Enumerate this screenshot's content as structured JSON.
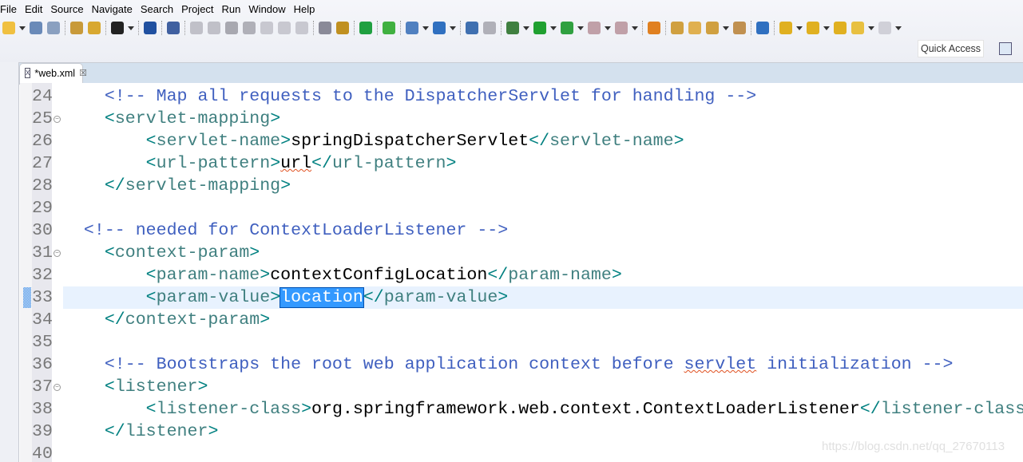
{
  "menu": [
    "File",
    "Edit",
    "Source",
    "Navigate",
    "Search",
    "Project",
    "Run",
    "Window",
    "Help"
  ],
  "toolbar": [
    {
      "icon": "new-icon",
      "c": "#f0c040"
    },
    {
      "dd": 1
    },
    {
      "icon": "save-icon",
      "c": "#6a8ab8"
    },
    {
      "icon": "save-all-icon",
      "c": "#8aa0c0"
    },
    {
      "sep": 1
    },
    {
      "icon": "open-type-icon",
      "c": "#c89a3a"
    },
    {
      "icon": "open-resource-icon",
      "c": "#d8a830"
    },
    {
      "sep": 1
    },
    {
      "icon": "user-icon",
      "c": "#222"
    },
    {
      "dd": 1
    },
    {
      "sep": 1
    },
    {
      "icon": "console-icon",
      "c": "#2050a0"
    },
    {
      "sep": 1
    },
    {
      "icon": "skip-breakpoints-icon",
      "c": "#4060a0"
    },
    {
      "sep": 1
    },
    {
      "icon": "resume-icon",
      "c": "#c0c0c8"
    },
    {
      "icon": "suspend-icon",
      "c": "#c0c0c8"
    },
    {
      "icon": "terminate-icon",
      "c": "#a8a8b0"
    },
    {
      "icon": "disconnect-icon",
      "c": "#b0b0b8"
    },
    {
      "icon": "step-into-icon",
      "c": "#c8c8d0"
    },
    {
      "icon": "step-over-icon",
      "c": "#c8c8d0"
    },
    {
      "icon": "step-return-icon",
      "c": "#c8c8d0"
    },
    {
      "sep": 1
    },
    {
      "icon": "drop-to-frame-icon",
      "c": "#8a8a98"
    },
    {
      "icon": "use-step-filters-icon",
      "c": "#c09020"
    },
    {
      "sep": 1
    },
    {
      "icon": "spring-boot-icon",
      "c": "#20a040"
    },
    {
      "sep": 1
    },
    {
      "icon": "spring-notification-icon",
      "c": "#40b040"
    },
    {
      "sep": 1
    },
    {
      "icon": "new-server-icon",
      "c": "#5080c0"
    },
    {
      "dd": 1
    },
    {
      "icon": "new-spring-icon",
      "c": "#3070c0"
    },
    {
      "dd": 1
    },
    {
      "sep": 1
    },
    {
      "icon": "run-server-icon",
      "c": "#4070b0"
    },
    {
      "icon": "misc-icon",
      "c": "#b0b0b8"
    },
    {
      "sep": 1
    },
    {
      "icon": "debug-icon",
      "c": "#408040"
    },
    {
      "dd": 1
    },
    {
      "icon": "run-icon",
      "c": "#20a030"
    },
    {
      "dd": 1
    },
    {
      "icon": "run-external-tools-icon",
      "c": "#30a040"
    },
    {
      "dd": 1
    },
    {
      "icon": "stop-icon",
      "c": "#c0a0a8"
    },
    {
      "dd": 1
    },
    {
      "icon": "deploy-icon",
      "c": "#c0a0a8"
    },
    {
      "dd": 1
    },
    {
      "sep": 1
    },
    {
      "icon": "open-aspectj-icon",
      "c": "#e08020"
    },
    {
      "sep": 1
    },
    {
      "icon": "open-project-icon",
      "c": "#d0a040"
    },
    {
      "icon": "open-folder-icon",
      "c": "#e0b050"
    },
    {
      "icon": "pen-icon",
      "c": "#d0a040"
    },
    {
      "dd": 1
    },
    {
      "icon": "open-archive-icon",
      "c": "#c09050"
    },
    {
      "sep": 1
    },
    {
      "icon": "globe-icon",
      "c": "#3070c0"
    },
    {
      "sep": 1
    },
    {
      "icon": "next-annotation-icon",
      "c": "#e0b020"
    },
    {
      "dd": 1
    },
    {
      "icon": "previous-annotation-icon",
      "c": "#e0b020"
    },
    {
      "dd": 1
    },
    {
      "icon": "last-edit-location-icon",
      "c": "#e0b020"
    },
    {
      "icon": "back-icon",
      "c": "#e8c040"
    },
    {
      "dd": 1
    },
    {
      "icon": "forward-icon",
      "c": "#d0d0d8"
    },
    {
      "dd": 1
    }
  ],
  "quick_access": "Quick Access",
  "tab": {
    "title": "*web.xml",
    "file_icon": "X",
    "close": "☒"
  },
  "current_line": 33,
  "lines": [
    {
      "n": "24",
      "seg": [
        [
          "cm",
          "    <!-- Map all requests to the DispatcherServlet for handling -->"
        ]
      ]
    },
    {
      "n": "25",
      "fold": 1,
      "seg": [
        [
          "tx",
          "    "
        ],
        [
          "br",
          "<"
        ],
        [
          "tag",
          "servlet-mapping"
        ],
        [
          "br",
          ">"
        ]
      ]
    },
    {
      "n": "26",
      "seg": [
        [
          "tx",
          "        "
        ],
        [
          "br",
          "<"
        ],
        [
          "tag",
          "servlet-name"
        ],
        [
          "br",
          ">"
        ],
        [
          "tx",
          "springDispatcherServlet"
        ],
        [
          "br",
          "</"
        ],
        [
          "tag",
          "servlet-name"
        ],
        [
          "br",
          ">"
        ]
      ]
    },
    {
      "n": "27",
      "seg": [
        [
          "tx",
          "        "
        ],
        [
          "br",
          "<"
        ],
        [
          "tag",
          "url-pattern"
        ],
        [
          "br",
          ">"
        ],
        [
          "sq",
          "url"
        ],
        [
          "br",
          "</"
        ],
        [
          "tag",
          "url-pattern"
        ],
        [
          "br",
          ">"
        ]
      ]
    },
    {
      "n": "28",
      "seg": [
        [
          "tx",
          "    "
        ],
        [
          "br",
          "</"
        ],
        [
          "tag",
          "servlet-mapping"
        ],
        [
          "br",
          ">"
        ]
      ]
    },
    {
      "n": "29",
      "seg": []
    },
    {
      "n": "30",
      "seg": [
        [
          "cm",
          "  <!-- needed for ContextLoaderListener -->"
        ]
      ]
    },
    {
      "n": "31",
      "fold": 1,
      "seg": [
        [
          "tx",
          "    "
        ],
        [
          "br",
          "<"
        ],
        [
          "tag",
          "context-param"
        ],
        [
          "br",
          ">"
        ]
      ]
    },
    {
      "n": "32",
      "seg": [
        [
          "tx",
          "        "
        ],
        [
          "br",
          "<"
        ],
        [
          "tag",
          "param-name"
        ],
        [
          "br",
          ">"
        ],
        [
          "tx",
          "contextConfigLocation"
        ],
        [
          "br",
          "</"
        ],
        [
          "tag",
          "param-name"
        ],
        [
          "br",
          ">"
        ]
      ]
    },
    {
      "n": "33",
      "seg": [
        [
          "tx",
          "        "
        ],
        [
          "br",
          "<"
        ],
        [
          "tag",
          "param-value"
        ],
        [
          "br",
          ">"
        ],
        [
          "sel",
          "location"
        ],
        [
          "br",
          "</"
        ],
        [
          "tag",
          "param-value"
        ],
        [
          "br",
          ">"
        ]
      ]
    },
    {
      "n": "34",
      "seg": [
        [
          "tx",
          "    "
        ],
        [
          "br",
          "</"
        ],
        [
          "tag",
          "context-param"
        ],
        [
          "br",
          ">"
        ]
      ]
    },
    {
      "n": "35",
      "seg": []
    },
    {
      "n": "36",
      "seg": [
        [
          "cm",
          "    <!-- Bootstraps the root web application context before "
        ],
        [
          "cmsq",
          "servlet"
        ],
        [
          "cm",
          " initialization -->"
        ]
      ]
    },
    {
      "n": "37",
      "fold": 1,
      "seg": [
        [
          "tx",
          "    "
        ],
        [
          "br",
          "<"
        ],
        [
          "tag",
          "listener"
        ],
        [
          "br",
          ">"
        ]
      ]
    },
    {
      "n": "38",
      "seg": [
        [
          "tx",
          "        "
        ],
        [
          "br",
          "<"
        ],
        [
          "tag",
          "listener-class"
        ],
        [
          "br",
          ">"
        ],
        [
          "tx",
          "org.springframework.web.context.ContextLoaderListener"
        ],
        [
          "br",
          "</"
        ],
        [
          "tag",
          "listener-class"
        ],
        [
          "br",
          ">"
        ]
      ]
    },
    {
      "n": "39",
      "seg": [
        [
          "tx",
          "    "
        ],
        [
          "br",
          "</"
        ],
        [
          "tag",
          "listener"
        ],
        [
          "br",
          ">"
        ]
      ]
    },
    {
      "n": "40",
      "seg": []
    }
  ],
  "watermark": "https://blog.csdn.net/qq_27670113"
}
